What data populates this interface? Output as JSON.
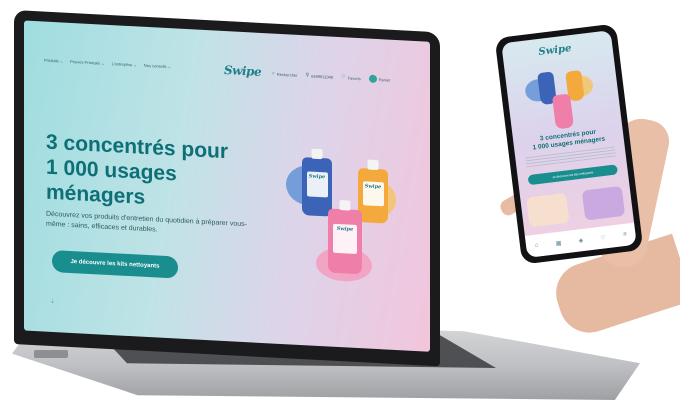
{
  "header": {
    "nav": [
      "Produits ⌄",
      "Pouvez-Français ⌄",
      "L'entreprise ⌄",
      "Nos conseils ⌄"
    ],
    "logo": "Swipe",
    "search_label": "Rechercher",
    "phone": "0489811040",
    "favorites_label": "Favoris",
    "cart_label": "Panier"
  },
  "hero": {
    "title_lines": [
      "3 concentrés pour",
      "1 000 usages",
      "ménagers"
    ],
    "subtitle": "Découvrez vos produits d'entretien du quotidien à préparer vous-même : sains, efficaces et durables.",
    "cta": "Je découvre les kits nettoyants"
  },
  "mobile": {
    "logo": "Swipe",
    "title_lines": [
      "3 concentrés pour",
      "1 000 usages ménagers"
    ],
    "cta": "Je découvre les kits nettoyants"
  },
  "colors": {
    "accent": "#1a8e8f",
    "title": "#0f6f77",
    "bottle_blue": "#3b63b8",
    "bottle_orange": "#f3a93b",
    "bottle_pink": "#ef7fa8"
  },
  "icons": [
    "search-icon",
    "user-icon",
    "heart-icon",
    "cart-icon",
    "mouse-scroll-icon"
  ]
}
